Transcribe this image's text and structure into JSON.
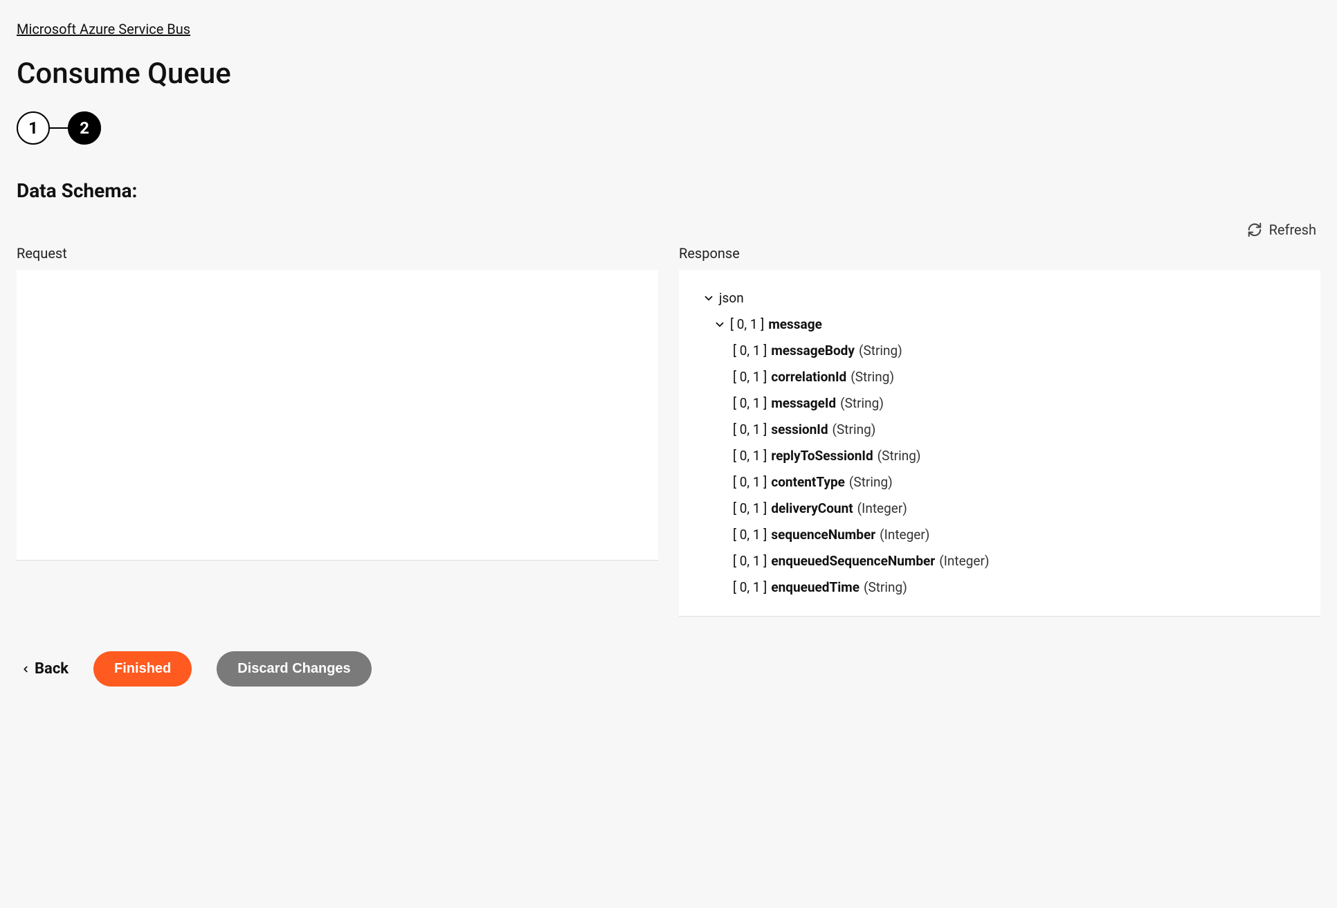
{
  "breadcrumb": "Microsoft Azure Service Bus",
  "page_title": "Consume Queue",
  "stepper": {
    "step1": "1",
    "step2": "2"
  },
  "section_title": "Data Schema:",
  "refresh_label": "Refresh",
  "panels": {
    "request_label": "Request",
    "response_label": "Response"
  },
  "response_tree": {
    "root": "json",
    "message_prefix": "[ 0, 1 ]",
    "message_name": "message",
    "fields": [
      {
        "prefix": "[ 0, 1 ]",
        "name": "messageBody",
        "type": "(String)"
      },
      {
        "prefix": "[ 0, 1 ]",
        "name": "correlationId",
        "type": "(String)"
      },
      {
        "prefix": "[ 0, 1 ]",
        "name": "messageId",
        "type": "(String)"
      },
      {
        "prefix": "[ 0, 1 ]",
        "name": "sessionId",
        "type": "(String)"
      },
      {
        "prefix": "[ 0, 1 ]",
        "name": "replyToSessionId",
        "type": "(String)"
      },
      {
        "prefix": "[ 0, 1 ]",
        "name": "contentType",
        "type": "(String)"
      },
      {
        "prefix": "[ 0, 1 ]",
        "name": "deliveryCount",
        "type": "(Integer)"
      },
      {
        "prefix": "[ 0, 1 ]",
        "name": "sequenceNumber",
        "type": "(Integer)"
      },
      {
        "prefix": "[ 0, 1 ]",
        "name": "enqueuedSequenceNumber",
        "type": "(Integer)"
      },
      {
        "prefix": "[ 0, 1 ]",
        "name": "enqueuedTime",
        "type": "(String)"
      }
    ]
  },
  "footer": {
    "back": "Back",
    "finished": "Finished",
    "discard": "Discard Changes"
  }
}
